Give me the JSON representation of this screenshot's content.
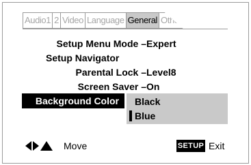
{
  "tabs": [
    {
      "label": "Audio1",
      "active": false
    },
    {
      "label": "2",
      "active": false
    },
    {
      "label": "Video",
      "active": false
    },
    {
      "label": "Language",
      "active": false
    },
    {
      "label": "General",
      "active": true
    },
    {
      "label": "Other",
      "active": false
    }
  ],
  "settings": {
    "setup_menu_mode": {
      "label": "Setup Menu Mode –",
      "value": "Expert"
    },
    "setup_navigator": {
      "label": "Setup Navigator"
    },
    "parental_lock": {
      "label": "Parental Lock –",
      "value": "Level8"
    },
    "screen_saver": {
      "label": "Screen Saver –",
      "value": "On"
    },
    "background_color": {
      "label": "Background Color"
    }
  },
  "background_color_options": [
    "Black",
    "Blue"
  ],
  "selected_option": "Blue",
  "footer": {
    "move_label": "Move",
    "setup_key_label": "SETUP",
    "exit_label": "Exit"
  },
  "colors": {
    "highlight_bg": "#000000",
    "option_bg": "#c9c9c9",
    "tab_active_bg": "#c9c9c9",
    "inactive_text": "#a6a6a6"
  },
  "icons": [
    "nav-left-icon",
    "nav-right-icon",
    "nav-up-icon"
  ]
}
